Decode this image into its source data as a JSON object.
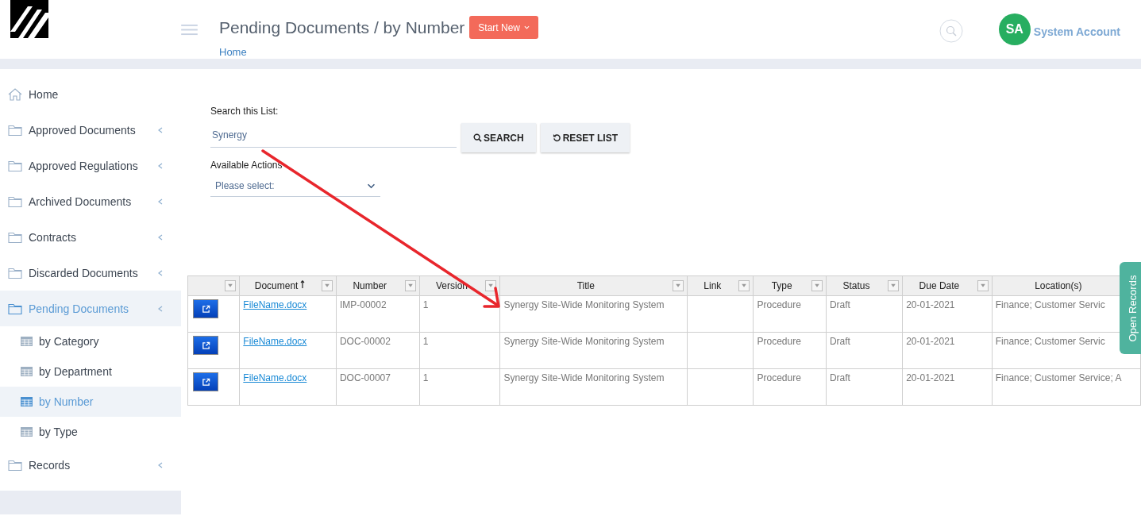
{
  "header": {
    "page_title": "Pending Documents / by Number",
    "start_button": "Start New",
    "breadcrumb": "Home",
    "avatar_initials": "SA",
    "account_name": "System Account"
  },
  "sidebar": {
    "items": [
      {
        "kind": "home",
        "label": "Home",
        "selected": false
      },
      {
        "kind": "folder",
        "label": "Approved Documents",
        "selected": false
      },
      {
        "kind": "folder",
        "label": "Approved Regulations",
        "selected": false
      },
      {
        "kind": "folder",
        "label": "Archived Documents",
        "selected": false
      },
      {
        "kind": "folder",
        "label": "Contracts",
        "selected": false
      },
      {
        "kind": "folder",
        "label": "Discarded Documents",
        "selected": false
      },
      {
        "kind": "folder",
        "label": "Pending Documents",
        "selected": true,
        "children": [
          {
            "label": "by Category",
            "selected": false
          },
          {
            "label": "by Department",
            "selected": false
          },
          {
            "label": "by Number",
            "selected": true
          },
          {
            "label": "by Type",
            "selected": false
          }
        ]
      },
      {
        "kind": "folder",
        "label": "Records",
        "selected": false
      }
    ]
  },
  "search": {
    "label": "Search this List:",
    "value": "Synergy",
    "search_button": "SEARCH",
    "reset_button": "RESET LIST"
  },
  "actions": {
    "label": "Available Actions",
    "placeholder": "Please select:"
  },
  "table": {
    "columns": [
      {
        "sorted": false
      },
      {
        "label": "Document",
        "sorted": true
      },
      {
        "label": "Number",
        "sorted": false
      },
      {
        "label": "Version",
        "sorted": false
      },
      {
        "label": "Title",
        "sorted": false
      },
      {
        "label": "Link",
        "sorted": false
      },
      {
        "label": "Type",
        "sorted": false
      },
      {
        "label": "Status",
        "sorted": false
      },
      {
        "label": "Due Date",
        "sorted": false
      },
      {
        "label": "Location(s)",
        "sorted": false
      }
    ],
    "rows": [
      {
        "document": "FileName.docx",
        "number": "IMP-00002",
        "version": "1",
        "title": "Synergy Site-Wide Monitoring System",
        "type": "Procedure",
        "status": "Draft",
        "due_date": "20-01-2021",
        "location": "Finance; Customer Servic"
      },
      {
        "document": "FileName.docx",
        "number": "DOC-00002",
        "version": "1",
        "title": "Synergy Site-Wide Monitoring System",
        "type": "Procedure",
        "status": "Draft",
        "due_date": "20-01-2021",
        "location": "Finance; Customer Servic"
      },
      {
        "document": "FileName.docx",
        "number": "DOC-00007",
        "version": "1",
        "title": "Synergy Site-Wide Monitoring System",
        "type": "Procedure",
        "status": "Draft",
        "due_date": "20-01-2021",
        "location": "Finance; Customer Service; A"
      }
    ]
  },
  "side_tab": "Open Records"
}
